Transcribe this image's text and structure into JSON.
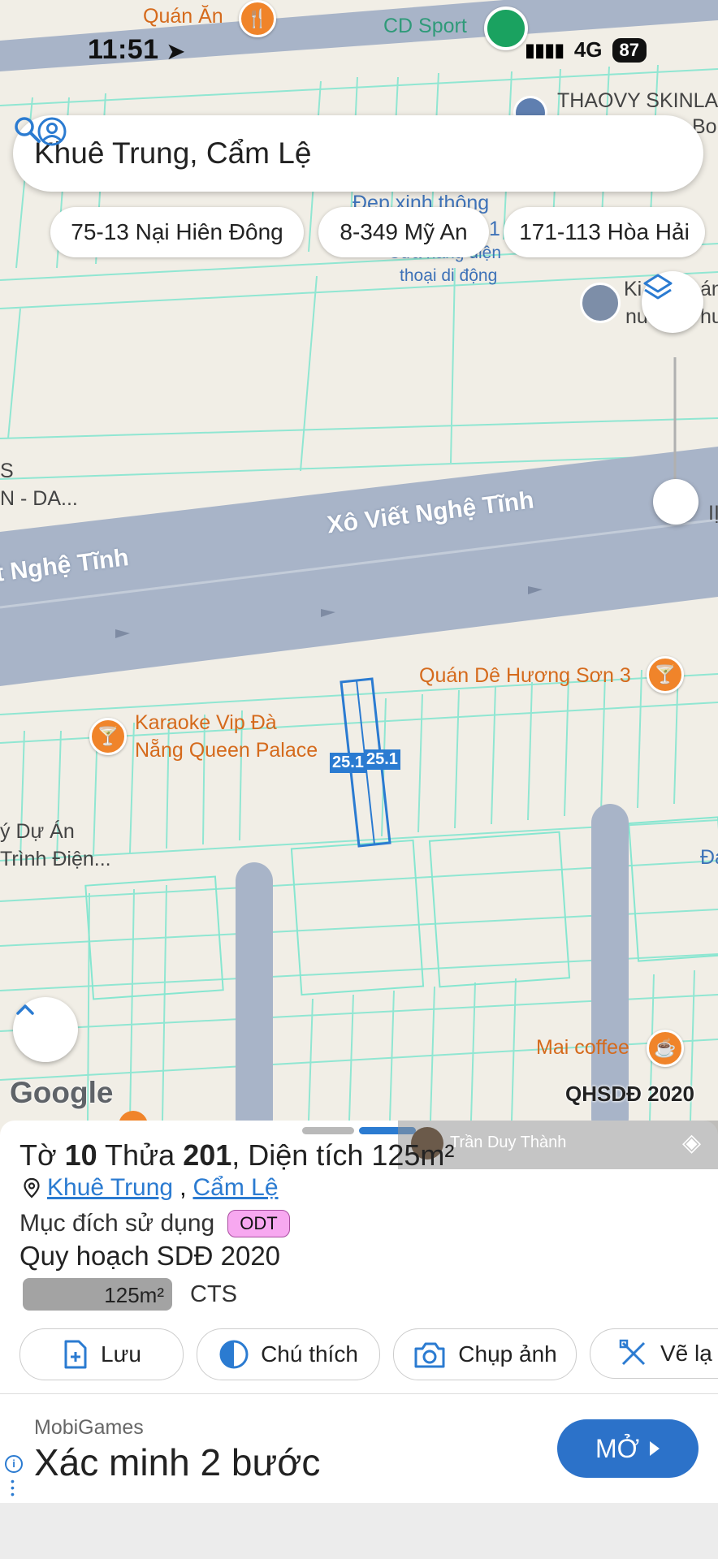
{
  "status": {
    "time": "11:51",
    "network": "4G",
    "battery": "87"
  },
  "search": {
    "text": "Khuê Trung, Cẩm Lệ"
  },
  "chips": [
    "75-13 Nại Hiên Đông",
    "8-349 Mỹ An",
    "171-113 Hòa Hải"
  ],
  "map": {
    "streets": [
      "Xô Viết Nghệ Tĩnh",
      "t Nghệ Tĩnh"
    ],
    "pois": {
      "quan_an": "Quán Ăn",
      "cd_sport": "CD Sport",
      "thaovy": "THAOVY SKINLA",
      "thaovy2": "Bo",
      "dep_xinh": "Đẹp xinh thông",
      "dep_xinh_num": "1",
      "cua_hang_line1": "Cửa hàng điện",
      "cua_hang_line2": "thoại di động",
      "ki_line1": "Ki",
      "ki_line1b": "án",
      "ki_line2": "nư",
      "ki_line2b": "hu",
      "left_s": "S",
      "left_da": "N - DA...",
      "quan_de": "Quán Dê Hương Sơn 3",
      "karaoke_line1": "Karaoke Vip Đà",
      "karaoke_line2": "Nẵng Queen Palace",
      "du_an_line1": "ý Dự Án",
      "du_an_line2": "Trình Điện...",
      "mai_coffee": "Mai coffee",
      "right_da": "Đa",
      "right_ll": "IỊ"
    },
    "parcel_labels": [
      "25.1",
      "25.1"
    ],
    "google": "Google",
    "qhsdd": "QHSDĐ 2020"
  },
  "user_overlay": {
    "name": "Trần Duy Thành"
  },
  "parcel": {
    "title_prefix": "Tờ",
    "sheet": "10",
    "title_mid": "Thửa",
    "plot": "201",
    "title_area_label": ", Diện tích",
    "area": "125m²",
    "ward": "Khuê Trung",
    "district": "Cẩm Lệ",
    "purpose_label": "Mục đích sử dụng",
    "purpose_code": "ODT",
    "plan": "Quy hoạch SDĐ 2020",
    "bar_value": "125m²",
    "bar_code": "CTS"
  },
  "actions": [
    "Lưu",
    "Chú thích",
    "Chụp ảnh",
    "Vẽ lạ"
  ],
  "ad": {
    "brand": "MobiGames",
    "title": "Xác minh 2 bước",
    "button": "MỞ"
  },
  "colors": {
    "accent": "#2b7bd1",
    "road": "#a8b4c8",
    "parcel_line": "#7ee3cc",
    "poi_orange": "#f0842a"
  }
}
